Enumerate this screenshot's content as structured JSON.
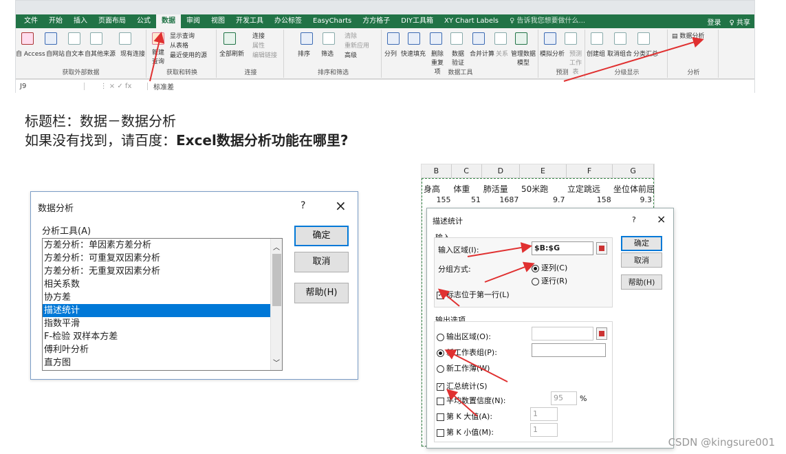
{
  "ribbon": {
    "tabs": [
      "文件",
      "开始",
      "插入",
      "页面布局",
      "公式",
      "数据",
      "审阅",
      "视图",
      "开发工具",
      "办公标签",
      "EasyCharts",
      "方方格子",
      "DIY工具箱",
      "XY Chart Labels"
    ],
    "active_tab": "数据",
    "tell_me": "♀ 告诉我您想要做什么...",
    "login": "登录",
    "share": "共享",
    "groups": {
      "get_external": "获取外部数据",
      "get_transform": "获取和转换",
      "connections": "连接",
      "sort_filter": "排序和筛选",
      "data_tools": "数据工具",
      "forecast": "预测",
      "outline": "分级显示",
      "analysis": "分析"
    },
    "buttons": {
      "from_access": "自 Access",
      "from_web": "自网站",
      "from_text": "自文本",
      "from_other": "自其他来源",
      "existing_conn": "现有连接",
      "new_query": "新建查询",
      "show_queries": "显示查询",
      "from_table": "从表格",
      "recent_sources": "最近使用的源",
      "refresh_all": "全部刷新",
      "connections": "连接",
      "properties": "属性",
      "edit_links": "编辑链接",
      "sort": "排序",
      "filter": "筛选",
      "clear": "清除",
      "reapply": "重新应用",
      "advanced": "高级",
      "text_to_columns": "分列",
      "flash_fill": "快速填充",
      "remove_duplicates": "删除重复项",
      "data_validation": "数据验证",
      "consolidate": "合并计算",
      "relationships": "关系",
      "data_model": "管理数据模型",
      "what_if": "模拟分析",
      "forecast_sheet": "预测工作表",
      "group": "创建组",
      "ungroup": "取消组合",
      "subtotal": "分类汇总",
      "data_analysis": "数据分析"
    }
  },
  "formula_bar": {
    "name_box": "J9",
    "icons": "⋮ × ✓ fx",
    "content": "标准差"
  },
  "notes": {
    "line1": "标题栏：数据－数据分析",
    "line2_prefix": "如果没有找到，请百度：",
    "line2_bold": "Excel数据分析功能在哪里?"
  },
  "dialog1": {
    "title": "数据分析",
    "help_glyph": "?",
    "close_glyph": "×",
    "list_label": "分析工具(A)",
    "items": [
      "方差分析：单因素方差分析",
      "方差分析：可重复双因素分析",
      "方差分析：无重复双因素分析",
      "相关系数",
      "协方差",
      "描述统计",
      "指数平滑",
      "F-检验 双样本方差",
      "傅利叶分析",
      "直方图"
    ],
    "selected": "描述统计",
    "ok": "确定",
    "cancel": "取消",
    "help": "帮助(H)"
  },
  "sheet": {
    "columns": [
      "B",
      "C",
      "D",
      "E",
      "F",
      "G"
    ],
    "headers": [
      "身高",
      "体重",
      "肺活量",
      "50米跑",
      "立定跳远",
      "坐位体前屈"
    ],
    "row1": [
      "155",
      "51",
      "1687",
      "9.7",
      "158",
      "9.3"
    ]
  },
  "dialog2": {
    "title": "描述统计",
    "help_glyph": "?",
    "close_glyph": "×",
    "input_section": "输入",
    "input_range_label": "输入区域(I):",
    "input_range_value": "$B:$G",
    "group_by_label": "分组方式:",
    "by_columns": "逐列(C)",
    "by_rows": "逐行(R)",
    "labels_first_row": "标志位于第一行(L)",
    "output_section": "输出选项",
    "output_range": "输出区域(O):",
    "new_sheet": "新工作表组(P):",
    "new_workbook": "新工作薄(W)",
    "summary_stats": "汇总统计(S)",
    "confidence": "平均数置信度(N):",
    "confidence_value": "95",
    "percent": "%",
    "kth_largest": "第 K 大值(A):",
    "kth_largest_value": "1",
    "kth_smallest": "第 K 小值(M):",
    "kth_smallest_value": "1",
    "ok": "确定",
    "cancel": "取消",
    "help": "帮助(H)"
  },
  "watermark": "CSDN @kingsure001",
  "colors": {
    "excel_green": "#217346",
    "arrow_red": "#e03030",
    "selection_blue": "#0078d7"
  }
}
